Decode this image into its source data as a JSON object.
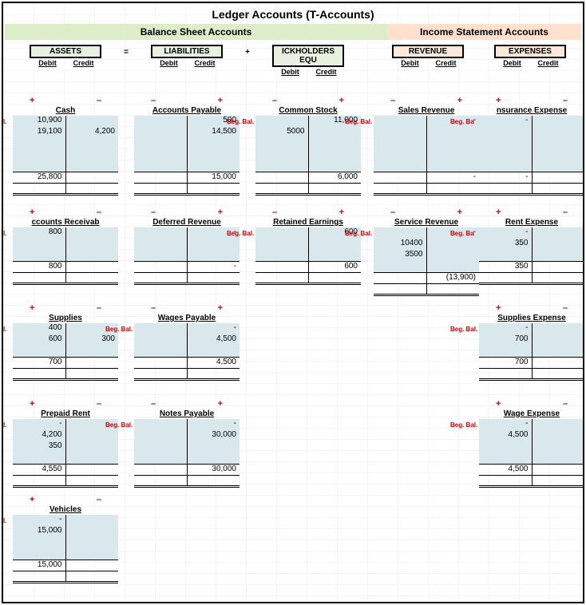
{
  "title": "Ledger Accounts (T-Accounts)",
  "sections": {
    "balance": "Balance Sheet Accounts",
    "income": "Income Statement Accounts"
  },
  "categories": {
    "assets": "ASSETS",
    "liab": "LIABILITIES",
    "equity": "ICKHOLDERS EQU",
    "rev": "REVENUE",
    "exp": "EXPENSES"
  },
  "dc": {
    "debit": "Debit",
    "credit": "Credit"
  },
  "op": {
    "eq": "=",
    "plus": "+"
  },
  "signs": {
    "plus": "+",
    "minus": "–"
  },
  "beg": "Beg. Bal.",
  "begShort": "eg. Bal.",
  "begShort2": "Beg. Ba",
  "accts": {
    "cash": {
      "name": "Cash",
      "dr": [
        "10,900",
        "19,100"
      ],
      "cr": [
        "",
        "4,200"
      ],
      "bal_dr": "25,800",
      "leftSign": "+",
      "rightSign": "–"
    },
    "ar": {
      "name": "ccounts Receivab",
      "dr": [
        "800"
      ],
      "cr": [
        ""
      ],
      "bal_dr": "800",
      "leftSign": "+",
      "rightSign": "–"
    },
    "supplies": {
      "name": "Supplies",
      "dr": [
        "400",
        "600"
      ],
      "cr": [
        "",
        "300"
      ],
      "bal_dr": "700",
      "leftSign": "+",
      "rightSign": "–"
    },
    "prepaid": {
      "name": "Prepaid Rent",
      "dr": [
        "-",
        "4,200",
        "350"
      ],
      "cr": [
        ""
      ],
      "bal_dr": "4,550",
      "leftSign": "+",
      "rightSign": "–"
    },
    "vehicles": {
      "name": "Vehicles",
      "dr": [
        "-",
        "15,000"
      ],
      "cr": [
        ""
      ],
      "bal_dr": "15,000",
      "leftSign": "+",
      "rightSign": "–"
    },
    "ap": {
      "name": "Accounts Payable",
      "dr": [
        ""
      ],
      "cr": [
        "500",
        "14,500"
      ],
      "bal_cr": "15,000",
      "leftSign": "–",
      "rightSign": "+"
    },
    "defrev": {
      "name": "Deferred Revenue",
      "dr": [
        ""
      ],
      "cr": [
        "-"
      ],
      "bal_cr": "-",
      "leftSign": "–",
      "rightSign": "+"
    },
    "wagespay": {
      "name": "Wages Payable",
      "dr": [
        ""
      ],
      "cr": [
        "-",
        "4,500"
      ],
      "bal_cr": "4,500",
      "leftSign": "–",
      "rightSign": "+"
    },
    "notes": {
      "name": "Notes Payable",
      "dr": [
        ""
      ],
      "cr": [
        "-",
        "30,000"
      ],
      "bal_cr": "30,000",
      "leftSign": "–",
      "rightSign": "+"
    },
    "common": {
      "name": "Common Stock",
      "dr": [
        "",
        "5000"
      ],
      "cr": [
        "11,000"
      ],
      "bal_cr": "6,000",
      "leftSign": "–",
      "rightSign": "+"
    },
    "retained": {
      "name": "Retained Earnings",
      "dr": [
        ""
      ],
      "cr": [
        "600"
      ],
      "bal_cr": "600",
      "leftSign": "–",
      "rightSign": "+"
    },
    "sales": {
      "name": "Sales Revenue",
      "dr": [
        ""
      ],
      "cr": [
        "-"
      ],
      "bal_cr": "-",
      "leftSign": "–",
      "rightSign": "+"
    },
    "service": {
      "name": "Service Revenue",
      "dr": [
        "",
        "10400",
        "3500"
      ],
      "cr": [
        "-"
      ],
      "bal_cr": "(13,900)",
      "leftSign": "–",
      "rightSign": "+"
    },
    "insurance": {
      "name": "nsurance Expense",
      "dr": [
        "-"
      ],
      "cr": [
        ""
      ],
      "bal_dr": "-",
      "leftSign": "+",
      "rightSign": "–"
    },
    "rent": {
      "name": "Rent Expense",
      "dr": [
        "-",
        "350"
      ],
      "cr": [
        ""
      ],
      "bal_dr": "350",
      "leftSign": "+",
      "rightSign": "–"
    },
    "suppliesexp": {
      "name": "Supplies Expense",
      "dr": [
        "-",
        "700"
      ],
      "cr": [
        ""
      ],
      "bal_dr": "700",
      "leftSign": "+",
      "rightSign": "–"
    },
    "wageexp": {
      "name": "Wage Expense",
      "dr": [
        "-",
        "4,500"
      ],
      "cr": [
        ""
      ],
      "bal_dr": "4,500",
      "leftSign": "+",
      "rightSign": "–"
    }
  },
  "chart_data": {
    "type": "table",
    "title": "Ledger Accounts (T-Accounts)",
    "accounts": [
      {
        "name": "Cash",
        "category": "Assets",
        "debits": [
          10900,
          19100
        ],
        "credits": [
          4200
        ],
        "balance": 25800,
        "side": "debit"
      },
      {
        "name": "Accounts Receivable",
        "category": "Assets",
        "debits": [
          800
        ],
        "credits": [],
        "balance": 800,
        "side": "debit"
      },
      {
        "name": "Supplies",
        "category": "Assets",
        "debits": [
          400,
          600
        ],
        "credits": [
          300
        ],
        "balance": 700,
        "side": "debit"
      },
      {
        "name": "Prepaid Rent",
        "category": "Assets",
        "debits": [
          4200,
          350
        ],
        "credits": [],
        "balance": 4550,
        "side": "debit"
      },
      {
        "name": "Vehicles",
        "category": "Assets",
        "debits": [
          15000
        ],
        "credits": [],
        "balance": 15000,
        "side": "debit"
      },
      {
        "name": "Accounts Payable",
        "category": "Liabilities",
        "debits": [],
        "credits": [
          500,
          14500
        ],
        "balance": 15000,
        "side": "credit"
      },
      {
        "name": "Deferred Revenue",
        "category": "Liabilities",
        "debits": [],
        "credits": [],
        "balance": 0,
        "side": "credit"
      },
      {
        "name": "Wages Payable",
        "category": "Liabilities",
        "debits": [],
        "credits": [
          4500
        ],
        "balance": 4500,
        "side": "credit"
      },
      {
        "name": "Notes Payable",
        "category": "Liabilities",
        "debits": [],
        "credits": [
          30000
        ],
        "balance": 30000,
        "side": "credit"
      },
      {
        "name": "Common Stock",
        "category": "Stockholders Equity",
        "debits": [
          5000
        ],
        "credits": [
          11000
        ],
        "balance": 6000,
        "side": "credit"
      },
      {
        "name": "Retained Earnings",
        "category": "Stockholders Equity",
        "debits": [],
        "credits": [
          600
        ],
        "balance": 600,
        "side": "credit"
      },
      {
        "name": "Sales Revenue",
        "category": "Revenue",
        "debits": [],
        "credits": [],
        "balance": 0,
        "side": "credit"
      },
      {
        "name": "Service Revenue",
        "category": "Revenue",
        "debits": [
          10400,
          3500
        ],
        "credits": [],
        "balance": -13900,
        "side": "credit"
      },
      {
        "name": "Insurance Expense",
        "category": "Expenses",
        "debits": [],
        "credits": [],
        "balance": 0,
        "side": "debit"
      },
      {
        "name": "Rent Expense",
        "category": "Expenses",
        "debits": [
          350
        ],
        "credits": [],
        "balance": 350,
        "side": "debit"
      },
      {
        "name": "Supplies Expense",
        "category": "Expenses",
        "debits": [
          700
        ],
        "credits": [],
        "balance": 700,
        "side": "debit"
      },
      {
        "name": "Wage Expense",
        "category": "Expenses",
        "debits": [
          4500
        ],
        "credits": [],
        "balance": 4500,
        "side": "debit"
      }
    ]
  }
}
